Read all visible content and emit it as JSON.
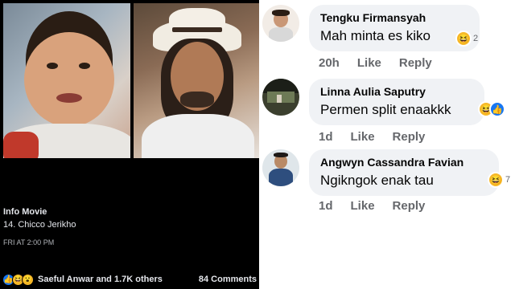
{
  "post": {
    "section_title": "Info Movie",
    "caption": "14. Chicco Jerikho",
    "timestamp": "FRI AT 2:00 PM",
    "reactors": "Saeful Anwar and 1.7K others",
    "comments_count": "84 Comments",
    "reaction_icons": [
      "like-icon",
      "haha-icon",
      "wow-icon"
    ]
  },
  "comments": [
    {
      "name": "Tengku Firmansyah",
      "text": "Mah minta es kiko",
      "age": "20h",
      "like_label": "Like",
      "reply_label": "Reply",
      "reaction_count": "2",
      "reactions": [
        "haha-icon"
      ]
    },
    {
      "name": "Linna Aulia Saputry",
      "text": "Permen split enaakkk",
      "age": "1d",
      "like_label": "Like",
      "reply_label": "Reply",
      "reaction_count": "",
      "reactions": [
        "haha-icon",
        "like-icon"
      ]
    },
    {
      "name": "Angwyn Cassandra Favian",
      "text": "Ngikngok enak tau",
      "age": "1d",
      "like_label": "Like",
      "reply_label": "Reply",
      "reaction_count": "7",
      "reactions": [
        "haha-icon"
      ]
    }
  ],
  "colors": {
    "facebook_blue": "#1877f2",
    "bubble_bg": "#f0f2f5",
    "meta_gray": "#65676b",
    "haha_yellow": "#f7b928"
  }
}
